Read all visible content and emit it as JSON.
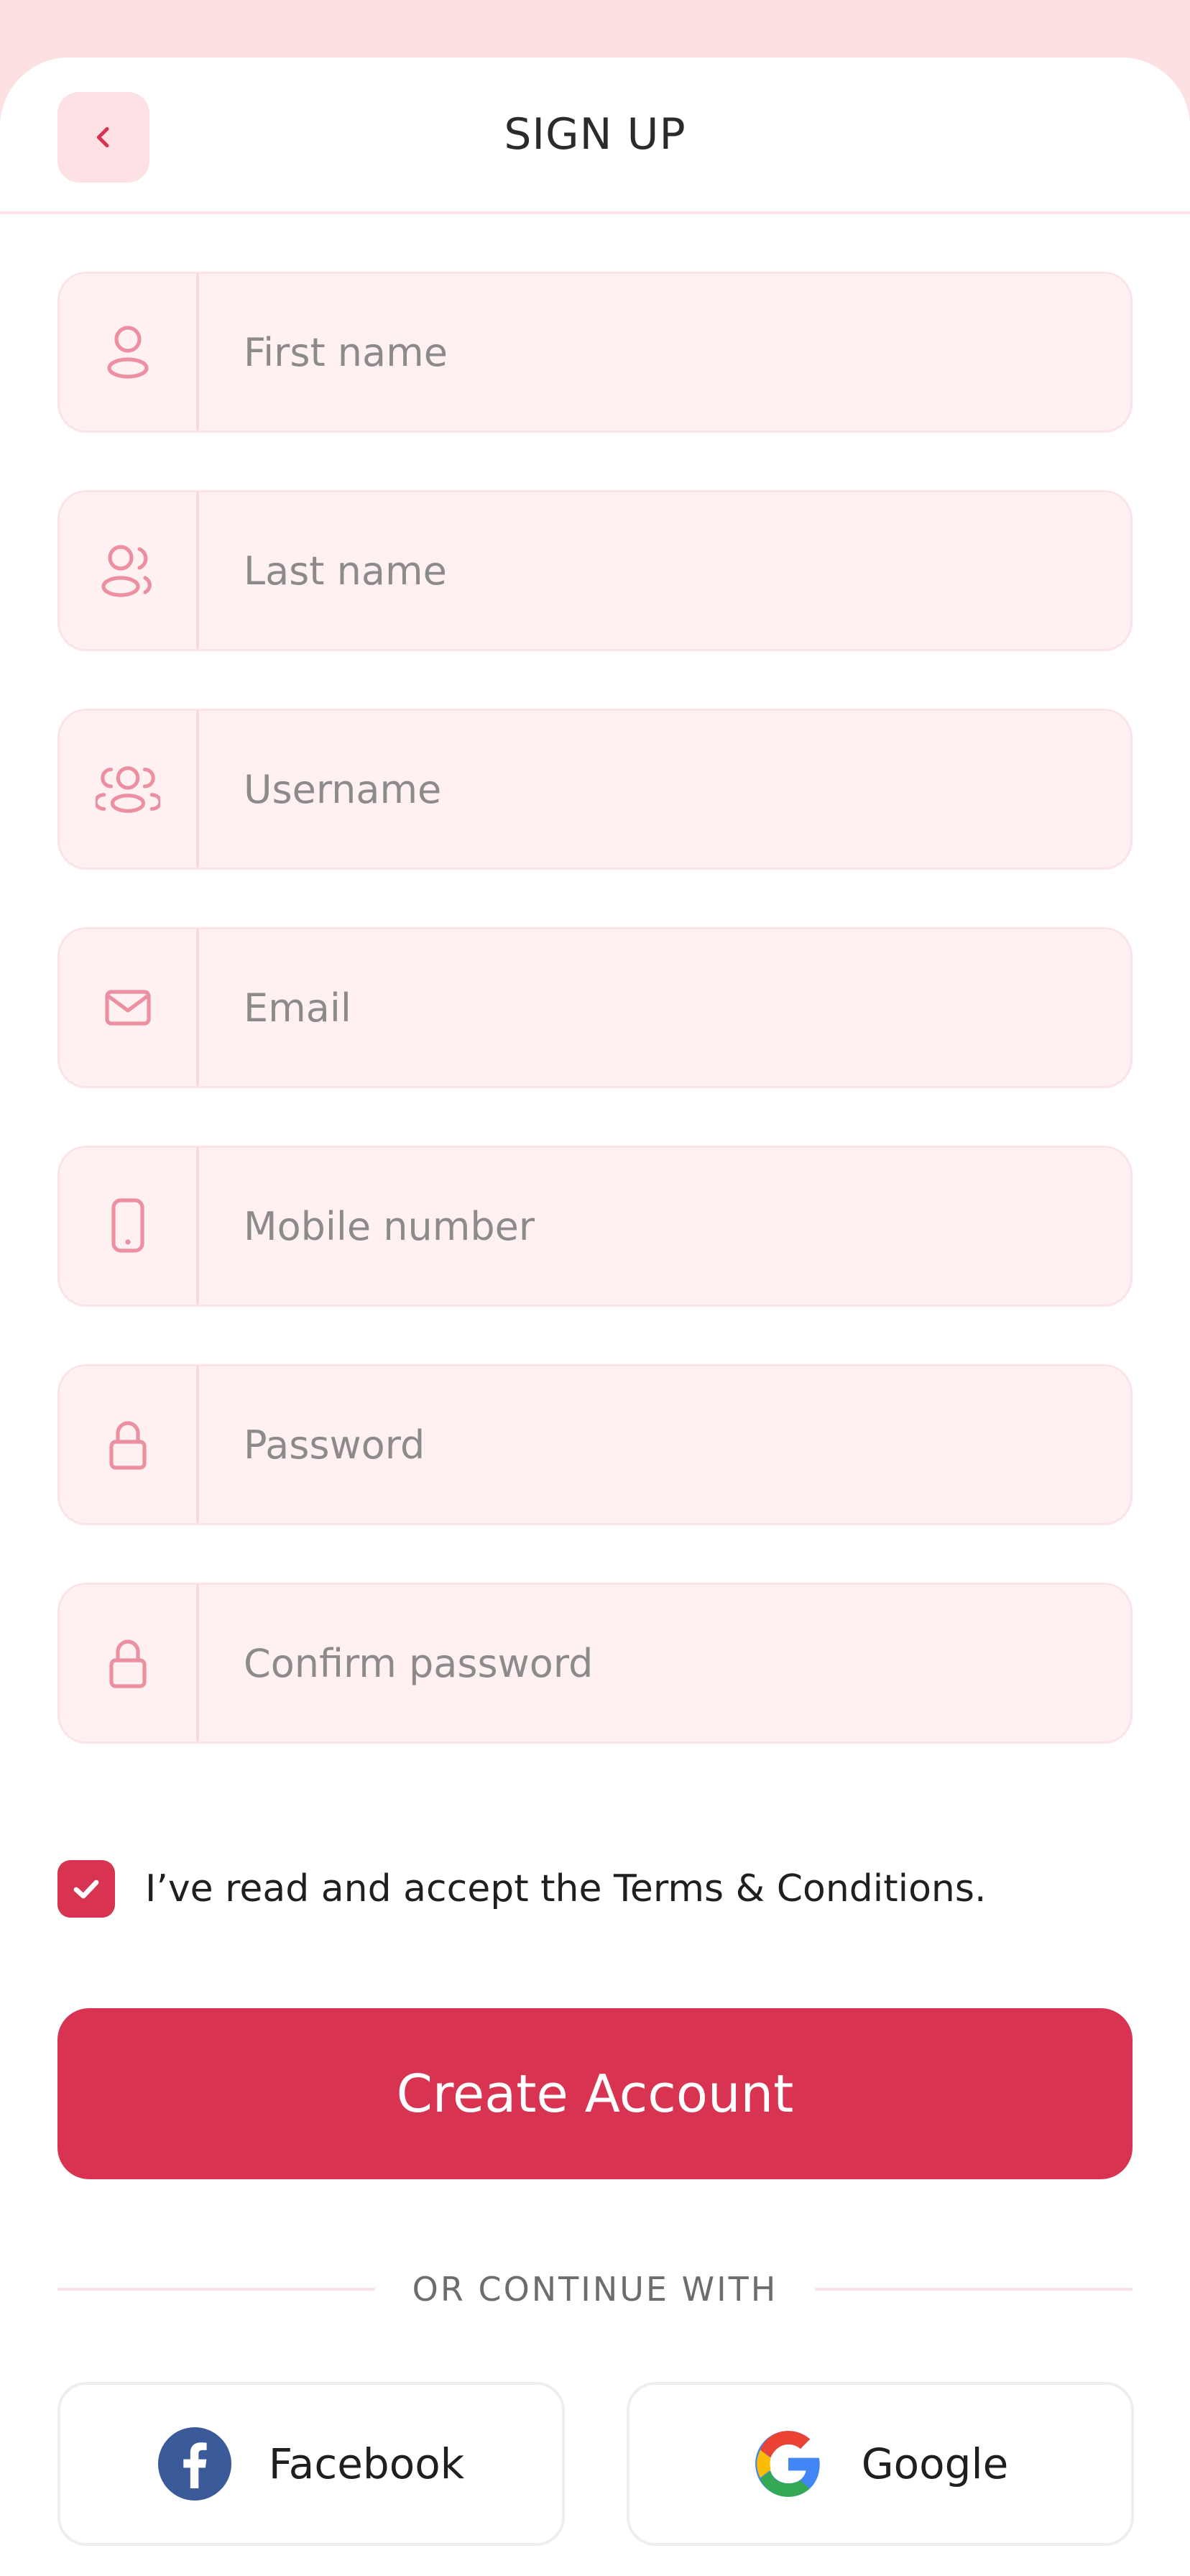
{
  "header": {
    "title": "SIGN UP",
    "back_icon": "chevron-left-icon"
  },
  "colors": {
    "accent": "#d93352",
    "field_bg": "#fff0f2",
    "icon": "#ec8fa1",
    "top_band": "#fde1e2"
  },
  "form": {
    "first_name": {
      "placeholder": "First name",
      "value": "",
      "icon": "user-icon"
    },
    "last_name": {
      "placeholder": "Last name",
      "value": "",
      "icon": "users-icon"
    },
    "username": {
      "placeholder": "Username",
      "value": "",
      "icon": "group-icon"
    },
    "email": {
      "placeholder": "Email",
      "value": "",
      "icon": "mail-icon"
    },
    "mobile": {
      "placeholder": "Mobile number",
      "value": "",
      "icon": "phone-icon"
    },
    "password": {
      "placeholder": "Password",
      "value": "",
      "icon": "lock-icon"
    },
    "confirm_password": {
      "placeholder": "Confirm password",
      "value": "",
      "icon": "lock-icon"
    }
  },
  "terms": {
    "label": "I’ve read and accept the Terms & Conditions.",
    "checked": true
  },
  "create_button": {
    "label": "Create Account"
  },
  "divider": {
    "label": "OR CONTINUE WITH"
  },
  "social": {
    "facebook": {
      "label": "Facebook",
      "icon": "facebook-icon"
    },
    "google": {
      "label": "Google",
      "icon": "google-icon"
    }
  }
}
